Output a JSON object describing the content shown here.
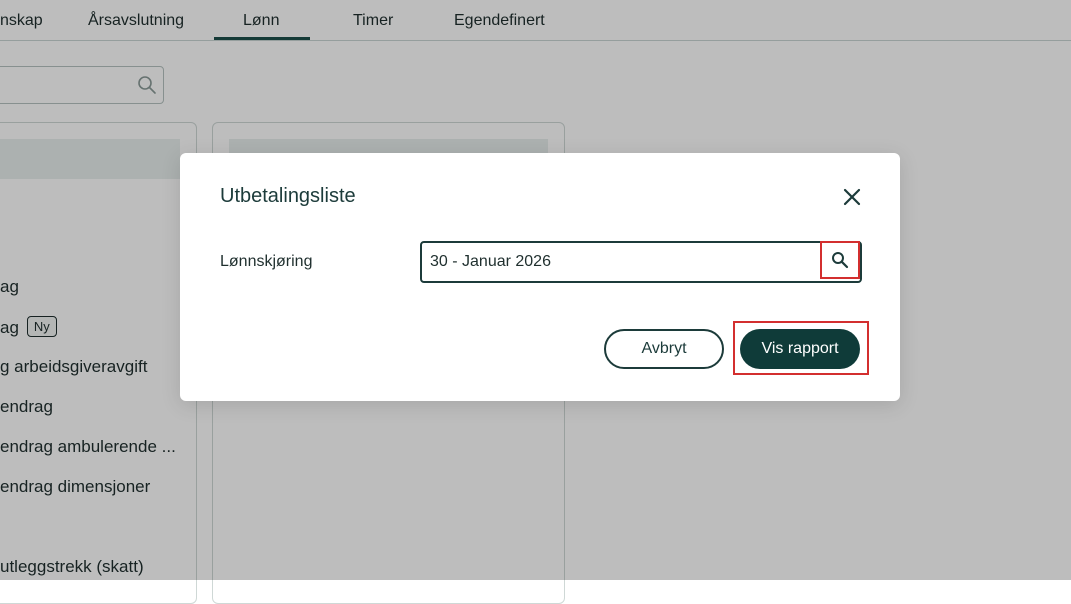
{
  "tabs": [
    {
      "label": "nskap"
    },
    {
      "label": "Årsavslutning"
    },
    {
      "label": "Lønn",
      "active": true
    },
    {
      "label": "Timer"
    },
    {
      "label": "Egendefinert"
    }
  ],
  "sidebar": {
    "items": [
      {
        "label": "ag"
      },
      {
        "label": "ag",
        "badge": "Ny"
      },
      {
        "label": "g arbeidsgiveravgift"
      },
      {
        "label": "endrag"
      },
      {
        "label": "endrag ambulerende ..."
      },
      {
        "label": "endrag dimensjoner"
      },
      {
        "label": "utleggstrekk (skatt)"
      }
    ]
  },
  "modal": {
    "title": "Utbetalingsliste",
    "field_label": "Lønnskjøring",
    "field_value": "30 - Januar 2026",
    "cancel_label": "Avbryt",
    "submit_label": "Vis rapport"
  },
  "colors": {
    "accent": "#0f3b39",
    "highlight_border": "#d32f2f",
    "overlay": "rgba(0,0,0,0.26)"
  },
  "icons": {
    "close": "close-icon",
    "search": "search-icon"
  }
}
